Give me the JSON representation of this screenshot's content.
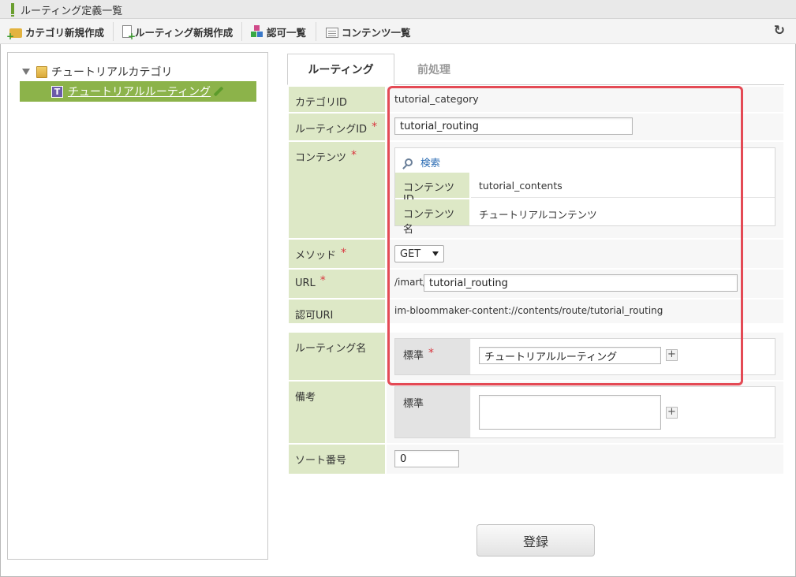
{
  "window": {
    "title": "ルーティング定義一覧"
  },
  "toolbar": {
    "new_category": "カテゴリ新規作成",
    "new_routing": "ルーティング新規作成",
    "authorization": "認可一覧",
    "contents_list": "コンテンツ一覧",
    "refresh_icon": "refresh-icon"
  },
  "tree": {
    "root_label": "チュートリアルカテゴリ",
    "child_badge": "T",
    "child_label": "チュートリアルルーティング"
  },
  "tabs": {
    "routing": "ルーティング",
    "preprocess": "前処理"
  },
  "form": {
    "category_id_label": "カテゴリID",
    "category_id_value": "tutorial_category",
    "routing_id_label": "ルーティングID",
    "routing_id_value": "tutorial_routing",
    "contents_label": "コンテンツ",
    "search_label": "検索",
    "contents_id_label": "コンテンツID",
    "contents_id_value": "tutorial_contents",
    "contents_name_label": "コンテンツ名",
    "contents_name_value": "チュートリアルコンテンツ",
    "method_label": "メソッド",
    "method_value": "GET",
    "url_label": "URL",
    "url_prefix": "/imart/",
    "url_value": "tutorial_routing",
    "auth_uri_label": "認可URI",
    "auth_uri_value": "im-bloommaker-content://contents/route/tutorial_routing",
    "routing_name_label": "ルーティング名",
    "standard_label": "標準",
    "routing_name_value": "チュートリアルルーティング",
    "remarks_label": "備考",
    "remarks_standard_label": "標準",
    "remarks_value": "",
    "sort_label": "ソート番号",
    "sort_value": "0",
    "required_mark": "*",
    "plus_label": "+"
  },
  "submit_label": "登録",
  "colors": {
    "highlight": "#e44a55",
    "label_bg": "#dde8c6",
    "tree_selected": "#8cb34a"
  }
}
